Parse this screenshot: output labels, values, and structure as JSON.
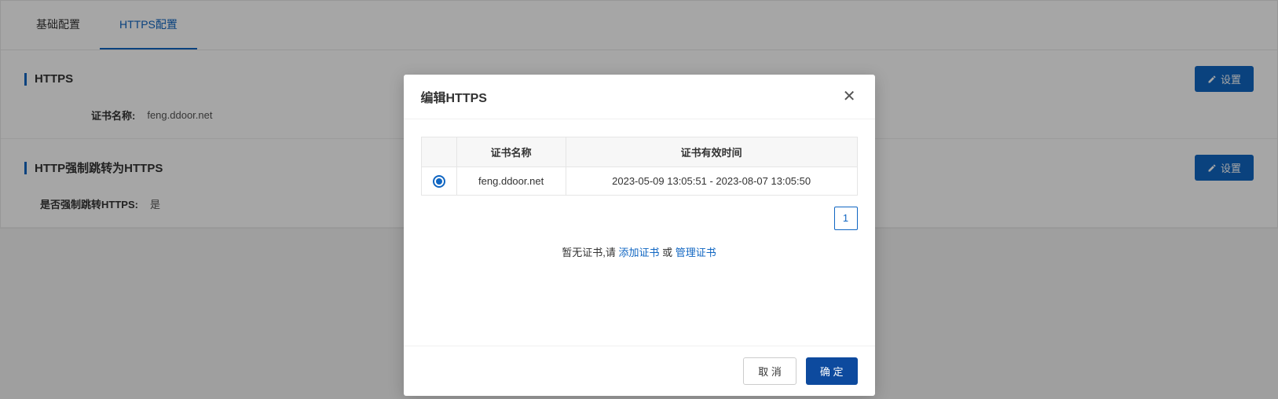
{
  "tabs": {
    "basic": "基础配置",
    "https": "HTTPS配置"
  },
  "sections": {
    "https": {
      "title": "HTTPS",
      "cert_name_label": "证书名称:",
      "cert_name_value": "feng.ddoor.net",
      "settings_btn": "设置"
    },
    "redirect": {
      "title": "HTTP强制跳转为HTTPS",
      "force_label": "是否强制跳转HTTPS:",
      "force_value": "是",
      "settings_btn": "设置"
    }
  },
  "modal": {
    "title": "编辑HTTPS",
    "table": {
      "col_radio": "",
      "col_name": "证书名称",
      "col_valid": "证书有效时间",
      "row_name": "feng.ddoor.net",
      "row_valid": "2023-05-09 13:05:51 - 2023-08-07 13:05:50"
    },
    "page": "1",
    "no_cert_prefix": "暂无证书,请 ",
    "add_cert": "添加证书",
    "or": " 或 ",
    "manage_cert": "管理证书",
    "cancel": "取 消",
    "confirm": "确 定"
  }
}
